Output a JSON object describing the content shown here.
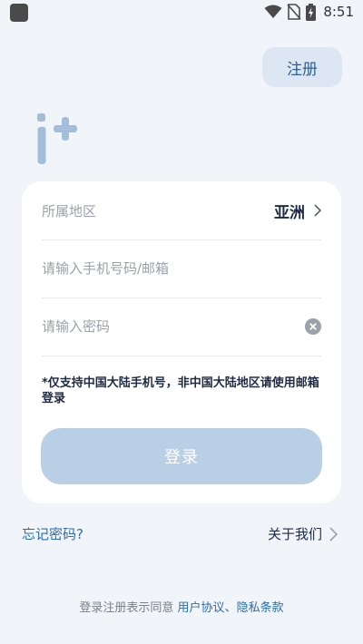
{
  "status_bar": {
    "time": "8:51"
  },
  "header": {
    "register_label": "注册"
  },
  "form": {
    "region_label": "所属地区",
    "region_value": "亚洲",
    "account_placeholder": "请输入手机号码/邮箱",
    "password_placeholder": "请输入密码",
    "notice": "*仅支持中国大陆手机号，非中国大陆地区请使用邮箱登录",
    "login_label": "登录"
  },
  "footer": {
    "forgot_label": "忘记密码?",
    "about_label": "关于我们",
    "agreement_prefix": "登录注册表示同意 ",
    "user_agreement": "用户协议",
    "separator": "、",
    "privacy_policy": "隐私条款"
  },
  "colors": {
    "accent": "#2e6cb0",
    "button_disabled": "#b9cfe6",
    "background": "#f1f4f9"
  }
}
